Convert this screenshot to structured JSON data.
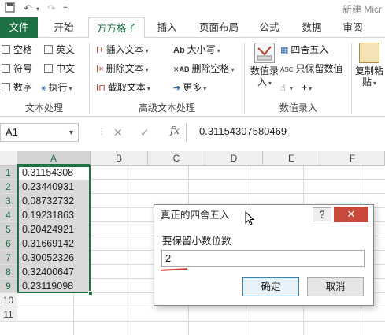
{
  "window": {
    "title": "新建 Micr"
  },
  "quick_access": {
    "save_icon": "save-icon",
    "undo_icon": "undo-icon",
    "redo_icon": "redo-icon"
  },
  "tabs": [
    {
      "label": "文件"
    },
    {
      "label": "开始"
    },
    {
      "label": "方方格子"
    },
    {
      "label": "插入"
    },
    {
      "label": "页面布局"
    },
    {
      "label": "公式"
    },
    {
      "label": "数据"
    },
    {
      "label": "审阅"
    }
  ],
  "ribbon": {
    "text_group": {
      "label": "文本处理",
      "items": [
        "空格",
        "英文",
        "符号",
        "中文",
        "数字",
        "执行"
      ]
    },
    "adv_group": {
      "label": "高级文本处理",
      "items": [
        "插入文本",
        "删除文本",
        "截取文本",
        "大小写",
        "删除空格",
        "更多"
      ]
    },
    "value_group": {
      "label": "数值录入",
      "big_button": "数值录\n入",
      "big_button_line1": "数值录",
      "big_button_line2": "入",
      "items": [
        "四舍五入",
        "只保留数值"
      ],
      "plus": "+"
    },
    "paste": {
      "line1": "复制粘",
      "line2": "贴"
    }
  },
  "formula_bar": {
    "cell_ref": "A1",
    "cancel": "✕",
    "enter": "✓",
    "fx": "fx",
    "value": "0.31154307580469"
  },
  "sheet": {
    "columns": [
      "A",
      "B",
      "C",
      "D",
      "E",
      "F"
    ],
    "rows": [
      "1",
      "2",
      "3",
      "4",
      "5",
      "6",
      "7",
      "8",
      "9",
      "10",
      "11"
    ],
    "a_values": [
      "0.31154308",
      "0.23440931",
      "0.08732732",
      "0.19231863",
      "0.20424921",
      "0.31669142",
      "0.30052326",
      "0.32400647",
      "0.23119098"
    ]
  },
  "dialog": {
    "title": "真正的四舍五入",
    "help": "?",
    "close": "✕",
    "label": "要保留小数位数",
    "input_value": "2",
    "ok": "确定",
    "cancel": "取消"
  },
  "colors": {
    "accent": "#1e7145",
    "close_red": "#c74a3c"
  }
}
